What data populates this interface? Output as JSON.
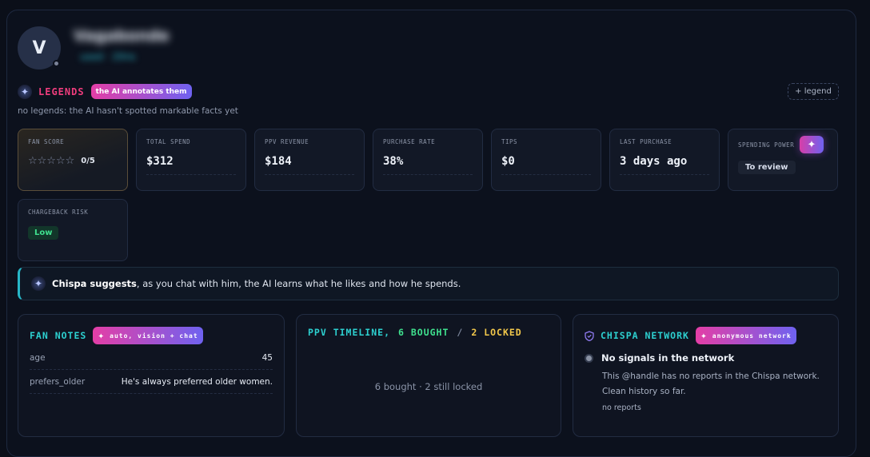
{
  "header": {
    "avatar_letter": "V",
    "name_blurred": "Vagabonde",
    "sub_blurred": "used · 20ns"
  },
  "legends": {
    "title": "LEGENDS",
    "badge": "the AI annotates them",
    "empty_note": "no legends: the AI hasn't spotted markable facts yet",
    "add_label": "+ legend"
  },
  "stats": {
    "fan_score": {
      "label": "FAN SCORE",
      "stars": "☆☆☆☆☆",
      "value": "0/5",
      "rating": 0
    },
    "total_spend": {
      "label": "TOTAL SPEND",
      "value": "$312"
    },
    "ppv_revenue": {
      "label": "PPV REVENUE",
      "value": "$184"
    },
    "purchase_rate": {
      "label": "PURCHASE RATE",
      "value": "38%"
    },
    "tips": {
      "label": "TIPS",
      "value": "$0"
    },
    "last_purchase": {
      "label": "LAST PURCHASE",
      "value": "3 days ago"
    },
    "spending_power": {
      "label": "SPENDING POWER",
      "value": "To review"
    },
    "chargeback_risk": {
      "label": "CHARGEBACK RISK",
      "value": "Low"
    }
  },
  "suggest": {
    "brand": "Chispa suggests",
    "text": ", as you chat with him, the AI learns what he likes and how he spends."
  },
  "fan_notes": {
    "title": "FAN NOTES",
    "badge": "auto, vision + chat",
    "rows": [
      {
        "key": "age",
        "value": "45"
      },
      {
        "key": "prefers_older",
        "value": "He's always preferred older women."
      }
    ]
  },
  "ppv_timeline": {
    "title": "PPV TIMELINE,",
    "bought": "6 BOUGHT",
    "slash": "/",
    "locked": "2 LOCKED",
    "summary": "6 bought · 2 still locked"
  },
  "network": {
    "title": "CHISPA NETWORK",
    "badge": "anonymous network",
    "status": "No signals in the network",
    "desc": "This @handle has no reports in the Chispa network. Clean history so far.",
    "foot": "no reports"
  },
  "colors": {
    "accent_cyan": "#2dd0d0",
    "legend_pink": "#ef3d7d",
    "good_green": "#3fe08e",
    "locked_yellow": "#f2c84b"
  }
}
